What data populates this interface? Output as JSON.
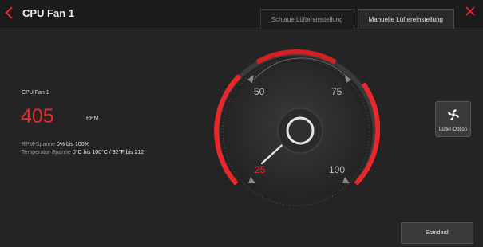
{
  "window": {
    "title": "CPU Fan 1",
    "back_icon": "chevron-left-icon",
    "close_icon": "close-icon"
  },
  "tabs": [
    {
      "label": "Schlaue Lüftereinstellung",
      "active": false
    },
    {
      "label": "Manuelle Lüftereinstellung",
      "active": true
    }
  ],
  "fan": {
    "name": "CPU Fan 1",
    "rpm": "405",
    "rpm_unit": "RPM",
    "rpm_range_label": "RPM-Spanne",
    "rpm_range_value": "0% bis 100%",
    "temp_range_label": "Temperatur-Spanne",
    "temp_range_value": "0°C bis 100°C / 32°F bis 212"
  },
  "gauge": {
    "labels": {
      "l25": "25",
      "l50": "50",
      "l75": "75",
      "l100": "100"
    },
    "needle_value_percent": 25
  },
  "buttons": {
    "fan_option_label": "Lüfter-Option",
    "fan_option_icon": "fan-icon",
    "standard_label": "Standard"
  },
  "colors": {
    "accent": "#e8282b",
    "background": "#242424"
  }
}
